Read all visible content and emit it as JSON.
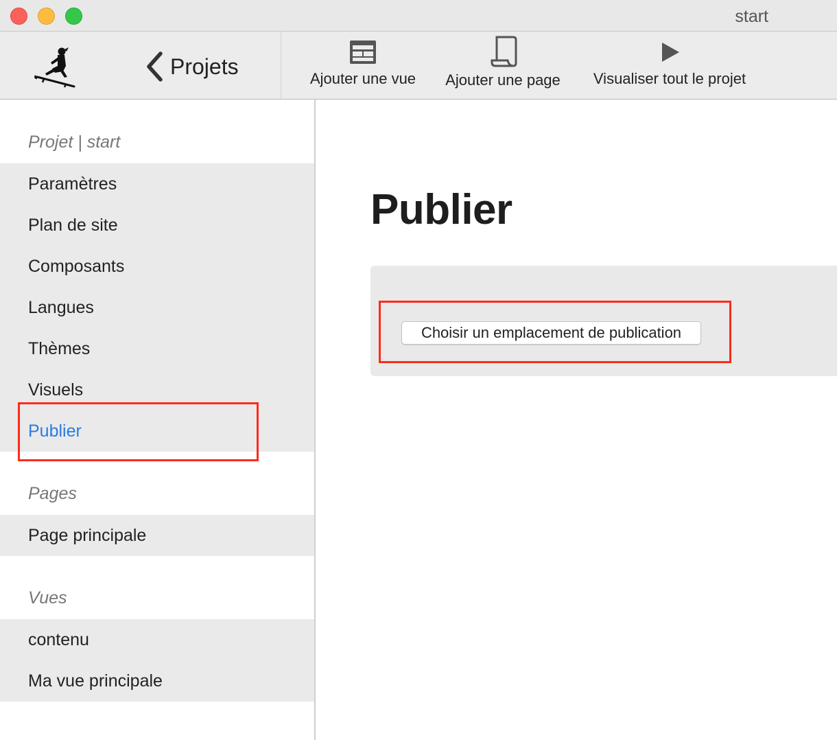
{
  "window": {
    "title": "start"
  },
  "toolbar": {
    "logo_icon": "sledge-rider-icon",
    "back_label": "Projets",
    "actions": [
      {
        "label": "Ajouter une vue",
        "icon": "view-layout-icon"
      },
      {
        "label": "Ajouter une page",
        "icon": "page-scroll-icon"
      },
      {
        "label": "Visualiser tout le projet",
        "icon": "play-icon"
      }
    ]
  },
  "sidebar": {
    "project_header": "Projet | start",
    "project_items": [
      "Paramètres",
      "Plan de site",
      "Composants",
      "Langues",
      "Thèmes",
      "Visuels",
      "Publier"
    ],
    "active_item": "Publier",
    "pages_header": "Pages",
    "pages_items": [
      "Page principale"
    ],
    "views_header": "Vues",
    "views_items": [
      "contenu",
      "Ma vue principale"
    ]
  },
  "main": {
    "title": "Publier",
    "choose_location_button": "Choisir un emplacement de publication"
  },
  "colors": {
    "active_link": "#2a7ae2",
    "highlight_box": "#ff2a1a",
    "sidebar_group_bg": "#eaeaea"
  }
}
